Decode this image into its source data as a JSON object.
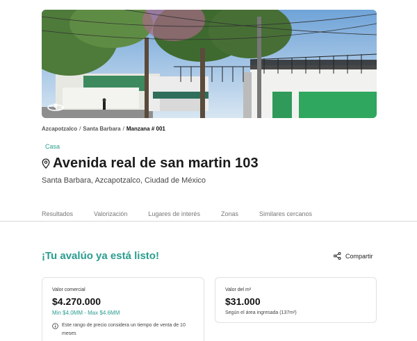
{
  "breadcrumb": {
    "items": [
      "Azcapotzalco",
      "Santa Barbara"
    ],
    "current": "Manzana # 001",
    "separator": "/"
  },
  "property": {
    "type": "Casa",
    "title": "Avenida real de san martin 103",
    "address": "Santa Barbara, Azcapotzalco, Ciudad de México"
  },
  "tabs": [
    "Resultados",
    "Valorización",
    "Lugares de interés",
    "Zonas",
    "Similares cercanos"
  ],
  "section": {
    "ready_title": "¡Tu avalúo ya está listo!",
    "share_label": "Compartir"
  },
  "cards": {
    "commercial": {
      "label": "Valor comercial",
      "value": "$4.270.000",
      "range": "Min $4.0MM - Max $4.6MM",
      "note": "Este rango de precio considera un tiempo de venta de 10 meses"
    },
    "m2": {
      "label": "Valor del m²",
      "value": "$31.000",
      "sub": "Según el área ingresada (137m²)"
    }
  },
  "colors": {
    "accent": "#2a9d8f",
    "text": "#1a1a1a",
    "muted": "#777777",
    "border": "#e1e1e1"
  },
  "icons": {
    "pin": "location-pin-icon",
    "share": "share-icon",
    "info": "info-icon",
    "rotate": "rotate-360-icon"
  }
}
